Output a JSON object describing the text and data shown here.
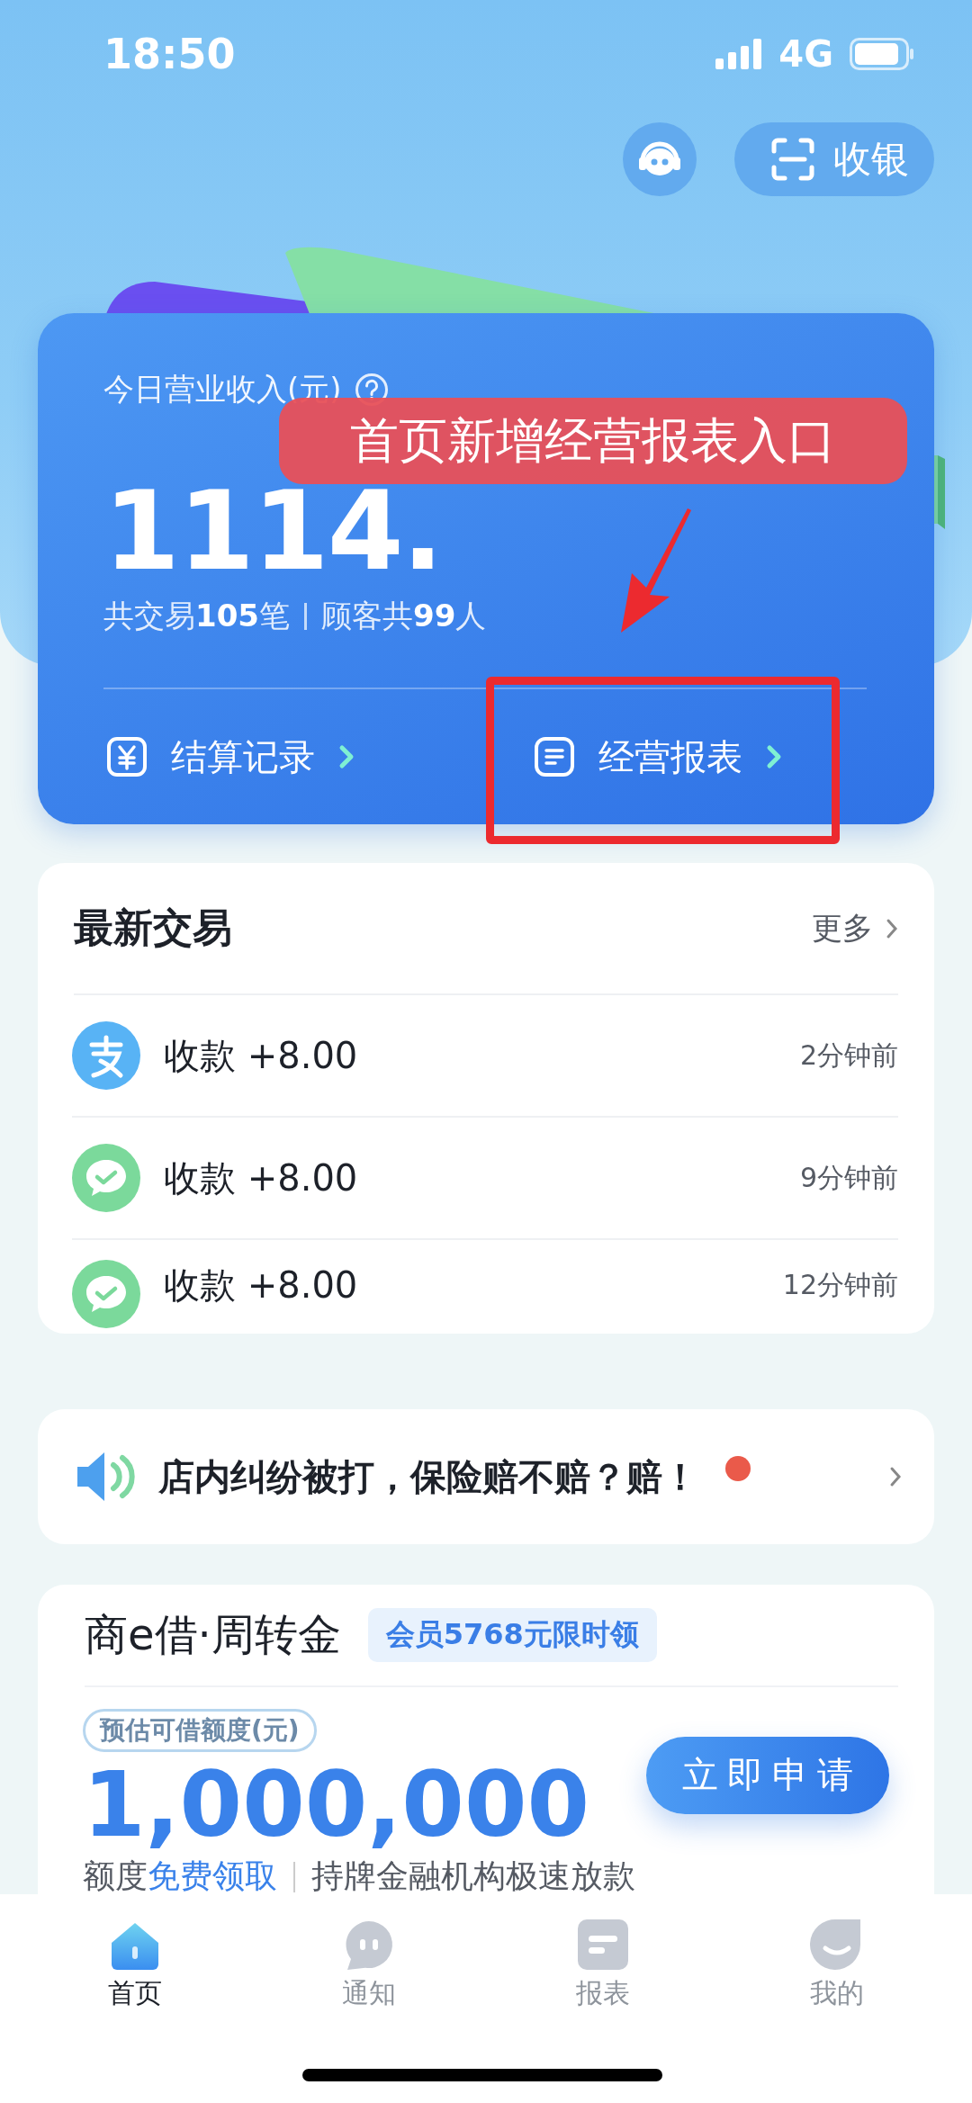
{
  "status_bar": {
    "time": "18:50",
    "network": "4G"
  },
  "header_actions": {
    "cashier_button": "收银"
  },
  "revenue_card": {
    "label": "今日营业收入(元)",
    "amount": "1114.",
    "stats": [
      "共交易**105**笔",
      "顾客共**99**人"
    ],
    "links": [
      {
        "kind": "yuan",
        "label": "结算记录"
      },
      {
        "kind": "report",
        "label": "经营报表"
      }
    ]
  },
  "annotation": {
    "text": "首页新增经营报表入口"
  },
  "recent_trades": {
    "title": "最新交易",
    "more": "更多",
    "items": [
      {
        "kind": "alipay",
        "text": "收款 +8.00",
        "time": "2分钟前"
      },
      {
        "kind": "wechat",
        "text": "收款 +8.00",
        "time": "9分钟前"
      },
      {
        "kind": "wechat",
        "text": "收款 +8.00",
        "time": "12分钟前"
      }
    ]
  },
  "notice": {
    "text": "店内纠纷被打，保险赔不赔？赔！",
    "unread": true
  },
  "loan": {
    "title": "商e借·周转金",
    "badge": "会员5768元限时领",
    "limit_label": "预估可借额度(元)",
    "amount": "1,000,000",
    "note_prefix": "额度",
    "note_link": "免费领取",
    "note_rest": "持牌金融机构极速放款",
    "apply_button": "立即申请"
  },
  "tab_bar": [
    {
      "kind": "home",
      "label": "首页",
      "selected": true
    },
    {
      "kind": "notice",
      "label": "通知",
      "selected": false
    },
    {
      "kind": "report",
      "label": "报表",
      "selected": false
    },
    {
      "kind": "mine",
      "label": "我的",
      "selected": false
    }
  ]
}
